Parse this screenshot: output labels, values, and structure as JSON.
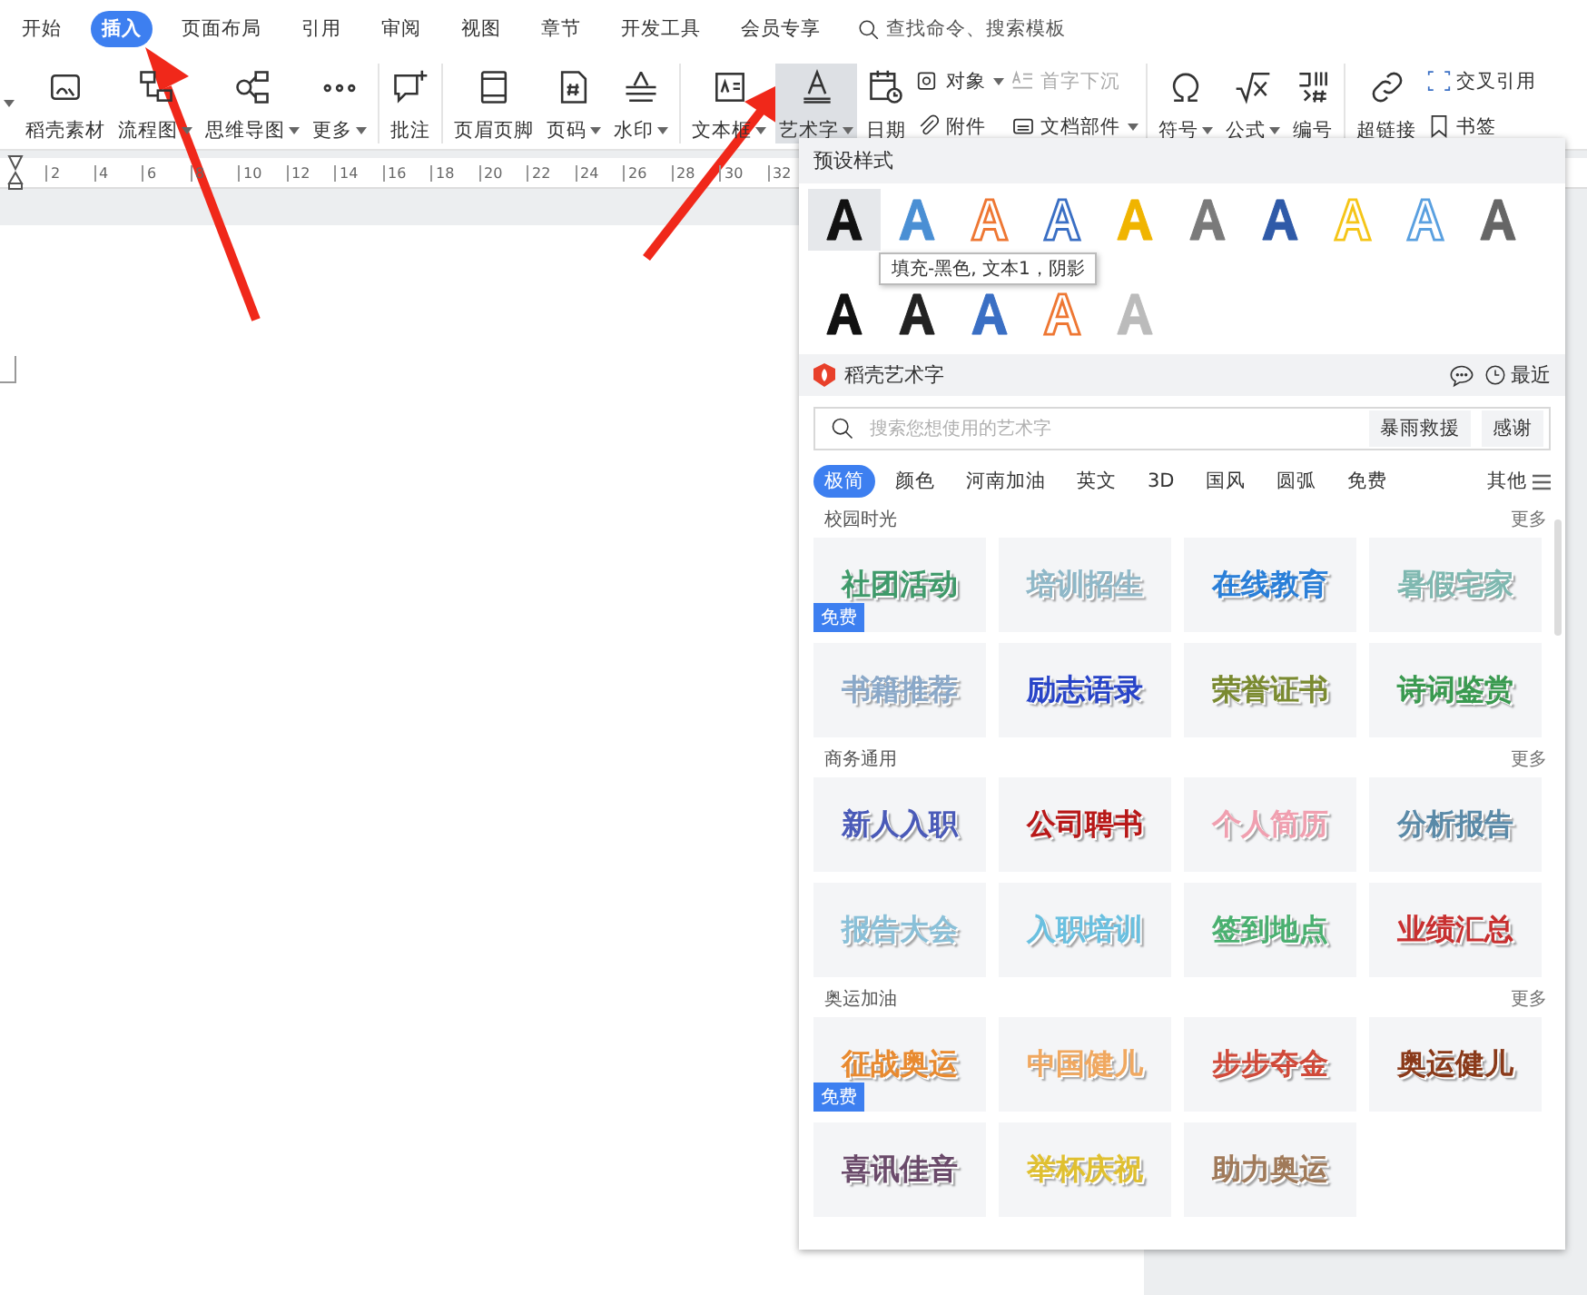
{
  "menu_tabs": [
    {
      "label": "开始",
      "selected": false
    },
    {
      "label": "插入",
      "selected": true
    },
    {
      "label": "页面布局",
      "selected": false
    },
    {
      "label": "引用",
      "selected": false
    },
    {
      "label": "审阅",
      "selected": false
    },
    {
      "label": "视图",
      "selected": false
    },
    {
      "label": "章节",
      "selected": false
    },
    {
      "label": "开发工具",
      "selected": false
    },
    {
      "label": "会员专享",
      "selected": false
    }
  ],
  "command_search": {
    "placeholder": "查找命令、搜索模板"
  },
  "ribbon_groups": [
    [
      {
        "kind": "big",
        "label": "稻壳素材",
        "dropdown": false,
        "selected": false
      },
      {
        "kind": "big",
        "label": "流程图",
        "dropdown": true,
        "selected": false
      },
      {
        "kind": "big",
        "label": "思维导图",
        "dropdown": true,
        "selected": false
      },
      {
        "kind": "big",
        "label": "更多",
        "dropdown": true,
        "selected": false
      }
    ],
    [
      {
        "kind": "big",
        "label": "批注",
        "dropdown": false,
        "selected": false
      }
    ],
    [
      {
        "kind": "big",
        "label": "页眉页脚",
        "dropdown": false,
        "selected": false
      },
      {
        "kind": "big",
        "label": "页码",
        "dropdown": true,
        "selected": false
      },
      {
        "kind": "big",
        "label": "水印",
        "dropdown": true,
        "selected": false
      }
    ],
    [
      {
        "kind": "big",
        "label": "文本框",
        "dropdown": true,
        "selected": false
      },
      {
        "kind": "big",
        "label": "艺术字",
        "dropdown": true,
        "selected": true
      },
      {
        "kind": "big",
        "label": "日期",
        "dropdown": false,
        "selected": false
      },
      {
        "kind": "stack",
        "items": [
          {
            "label": "对象",
            "dropdown": true,
            "disabled": false
          },
          {
            "label": "附件",
            "dropdown": false,
            "disabled": false
          }
        ]
      },
      {
        "kind": "stack",
        "items": [
          {
            "label": "首字下沉",
            "dropdown": false,
            "disabled": true
          },
          {
            "label": "文档部件",
            "dropdown": true,
            "disabled": false
          }
        ]
      }
    ],
    [
      {
        "kind": "big",
        "label": "符号",
        "dropdown": true,
        "selected": false
      },
      {
        "kind": "big",
        "label": "公式",
        "dropdown": true,
        "selected": false
      },
      {
        "kind": "big",
        "label": "编号",
        "dropdown": false,
        "selected": false
      }
    ],
    [
      {
        "kind": "big",
        "label": "超链接",
        "dropdown": false,
        "selected": false
      },
      {
        "kind": "stack",
        "items": [
          {
            "label": "交叉引用",
            "dropdown": false,
            "disabled": false
          },
          {
            "label": "书签",
            "dropdown": false,
            "disabled": false
          }
        ]
      }
    ]
  ],
  "ruler_labels": [
    "2",
    "4",
    "6",
    "8",
    "10",
    "12",
    "14",
    "16",
    "18",
    "20",
    "22",
    "24",
    "26",
    "28",
    "30",
    "32"
  ],
  "wordart_panel": {
    "preset_title": "预设样式",
    "presets": [
      {
        "kind": "fill",
        "color": "#111111",
        "selected": true
      },
      {
        "kind": "fill",
        "color": "#4a8fd4",
        "selected": false
      },
      {
        "kind": "outline",
        "color": "#ee7733",
        "selected": false
      },
      {
        "kind": "outline",
        "color": "#3a6fc4",
        "selected": false
      },
      {
        "kind": "fill",
        "color": "#f0b400",
        "selected": false
      },
      {
        "kind": "fill",
        "color": "#7a7a7a",
        "selected": false
      },
      {
        "kind": "fill",
        "color": "#2f5aa8",
        "selected": false
      },
      {
        "kind": "outline",
        "color": "#f5c518",
        "selected": false
      },
      {
        "kind": "outline",
        "color": "#5aa0e0",
        "selected": false
      },
      {
        "kind": "fill",
        "color": "#666666",
        "selected": false
      },
      {
        "kind": "fill",
        "color": "#111111",
        "selected": false
      },
      {
        "kind": "fill",
        "color": "#222222",
        "selected": false
      },
      {
        "kind": "fill",
        "color": "#3a6fc4",
        "selected": false
      },
      {
        "kind": "outline",
        "color": "#ee7733",
        "selected": false
      },
      {
        "kind": "fill",
        "color": "#bbbbbb",
        "selected": false
      }
    ],
    "tooltip": "填充-黑色, 文本1，阴影",
    "online_title": "稻壳艺术字",
    "recent": "最近",
    "search": {
      "placeholder": "搜索您想使用的艺术字"
    },
    "hot_words": [
      "暴雨救援",
      "感谢"
    ],
    "categories": [
      {
        "label": "极简",
        "selected": true
      },
      {
        "label": "颜色",
        "selected": false
      },
      {
        "label": "河南加油",
        "selected": false
      },
      {
        "label": "英文",
        "selected": false
      },
      {
        "label": "3D",
        "selected": false
      },
      {
        "label": "国风",
        "selected": false
      },
      {
        "label": "圆弧",
        "selected": false
      },
      {
        "label": "免费",
        "selected": false
      }
    ],
    "other": "其他",
    "groups": [
      {
        "title": "校园时光",
        "more": "更多",
        "tiles": [
          {
            "text": "社团活动",
            "color": "#3f9a6a",
            "badge": "免费"
          },
          {
            "text": "培训招生",
            "color": "#8fb8c8"
          },
          {
            "text": "在线教育",
            "color": "#2a7fd8"
          },
          {
            "text": "暑假宅家",
            "color": "#7fb8b0"
          },
          {
            "text": "书籍推荐",
            "color": "#8aa8c8"
          },
          {
            "text": "励志语录",
            "color": "#2844c8"
          },
          {
            "text": "荣誉证书",
            "color": "#7a8a30"
          },
          {
            "text": "诗词鉴赏",
            "color": "#3a9a50"
          }
        ]
      },
      {
        "title": "商务通用",
        "more": "更多",
        "tiles": [
          {
            "text": "新人入职",
            "color": "#4a5ab8"
          },
          {
            "text": "公司聘书",
            "color": "#b81818"
          },
          {
            "text": "个人简历",
            "color": "#f0a0b0"
          },
          {
            "text": "分析报告",
            "color": "#5a8aa8"
          },
          {
            "text": "报告大会",
            "color": "#8ac0d8"
          },
          {
            "text": "入职培训",
            "color": "#6ac0e0"
          },
          {
            "text": "签到地点",
            "color": "#4ab070"
          },
          {
            "text": "业绩汇总",
            "color": "#c83030"
          }
        ]
      },
      {
        "title": "奥运加油",
        "more": "更多",
        "tiles": [
          {
            "text": "征战奥运",
            "color": "#e88a30",
            "badge": "免费"
          },
          {
            "text": "中国健儿",
            "color": "#f0a860"
          },
          {
            "text": "步步夺金",
            "color": "#d04a3a"
          },
          {
            "text": "奥运健儿",
            "color": "#8a3a1a"
          },
          {
            "text": "喜讯佳音",
            "color": "#6a4a6a"
          },
          {
            "text": "举杯庆祝",
            "color": "#e0c030"
          },
          {
            "text": "助力奥运",
            "color": "#a07a5a"
          }
        ]
      }
    ]
  }
}
